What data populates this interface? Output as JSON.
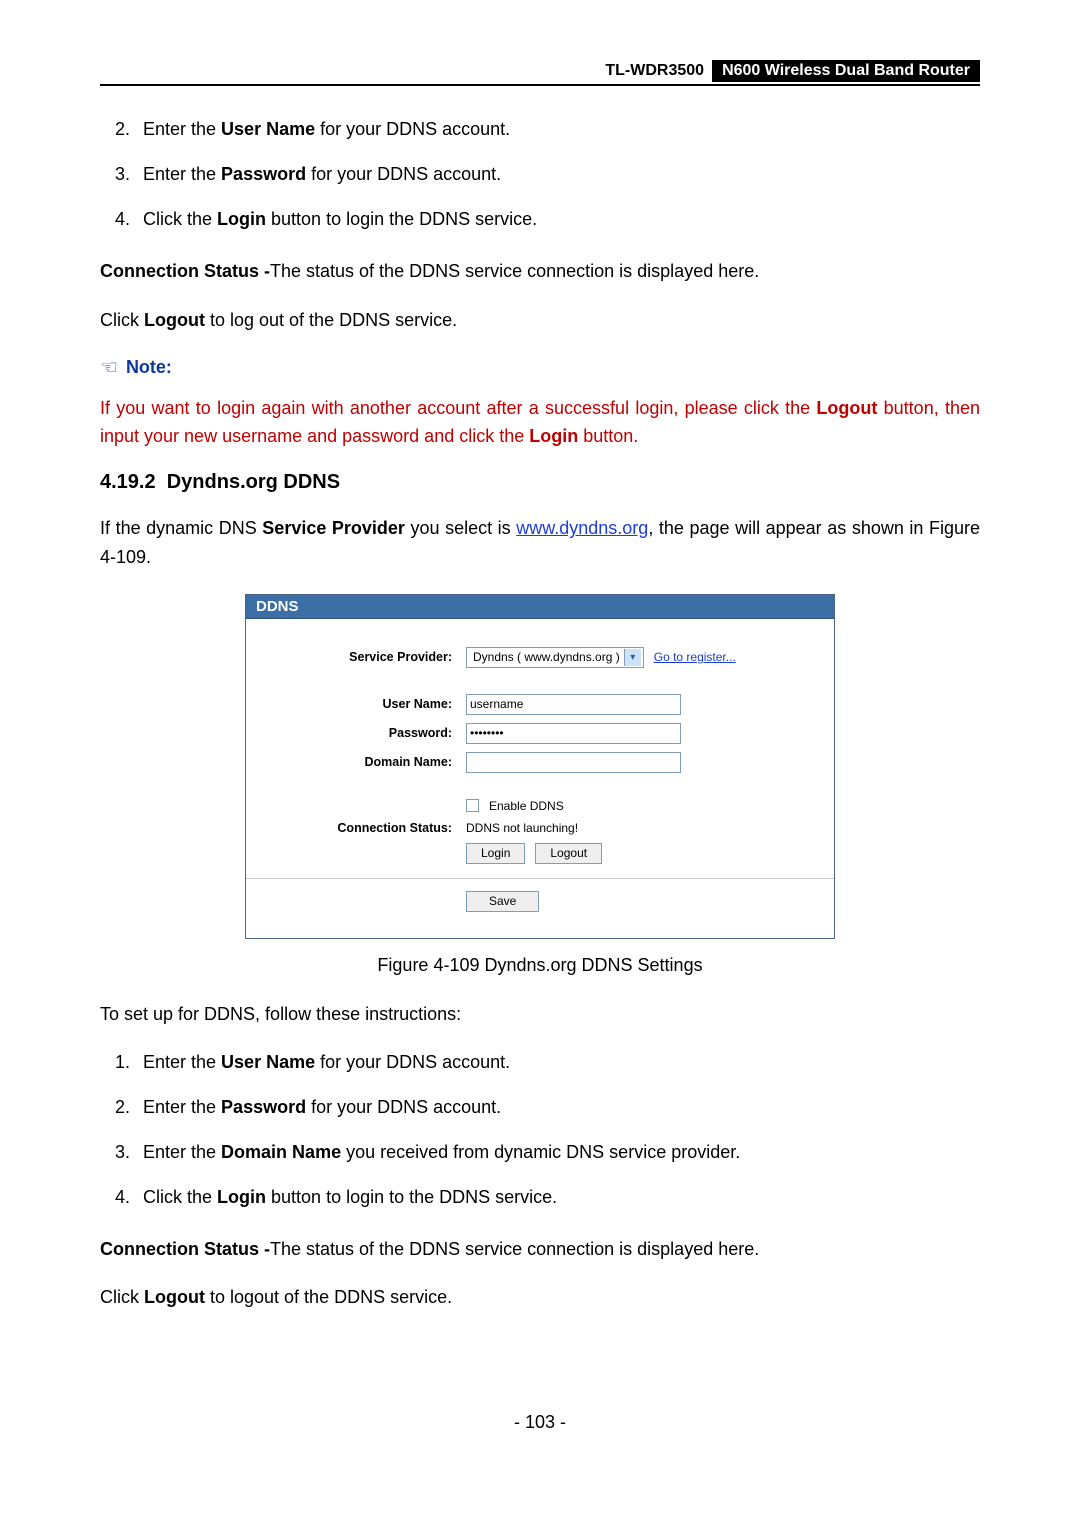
{
  "header": {
    "model": "TL-WDR3500",
    "desc": "N600 Wireless Dual Band Router"
  },
  "topSteps": [
    {
      "n": 2,
      "pre": "Enter the ",
      "b": "User Name",
      "post": " for your DDNS account."
    },
    {
      "n": 3,
      "pre": "Enter the ",
      "b": "Password",
      "post": " for your DDNS account."
    },
    {
      "n": 4,
      "pre": "Click the ",
      "b": "Login",
      "post": " button to login the DDNS service."
    }
  ],
  "connStatus1": {
    "b": "Connection Status -",
    "t": "The status of the DDNS service connection is displayed here."
  },
  "logout1": {
    "pre": "Click ",
    "b": "Logout",
    "post": " to log out of the DDNS service."
  },
  "noteLabel": "Note:",
  "noteBody": {
    "t1": " If you want to login again with another account after a successful login, please click the ",
    "b1": "Logout",
    "t2": " button, then input your new username and password and click the ",
    "b2": "Login",
    "t3": " button."
  },
  "section": {
    "num": "4.19.2",
    "title": "Dyndns.org DDNS"
  },
  "intro": {
    "t1": "If the dynamic DNS ",
    "b1": "Service Provider",
    "t2": " you select is ",
    "link": "www.dyndns.org",
    "t3": ", the page will appear as shown in Figure 4-109."
  },
  "figure": {
    "title": "DDNS",
    "labels": {
      "provider": "Service Provider:",
      "user": "User Name:",
      "pass": "Password:",
      "domain": "Domain Name:",
      "conn": "Connection Status:"
    },
    "providerValue": "Dyndns ( www.dyndns.org )",
    "registerLink": "Go to register...",
    "userValue": "username",
    "passValue": "••••••••",
    "enableDDNS": "Enable DDNS",
    "connValue": "DDNS not launching!",
    "loginBtn": "Login",
    "logoutBtn": "Logout",
    "saveBtn": "Save"
  },
  "caption": "Figure 4-109 Dyndns.org DDNS Settings",
  "setup": "To set up for DDNS, follow these instructions:",
  "bottomSteps": [
    {
      "pre": "Enter the ",
      "b": "User Name",
      "post": " for your DDNS account."
    },
    {
      "pre": "Enter the ",
      "b": "Password",
      "post": " for your DDNS account."
    },
    {
      "pre": "Enter the ",
      "b": "Domain Name",
      "post": " you received from dynamic DNS service provider."
    },
    {
      "pre": "Click the ",
      "b": "Login",
      "post": " button to login to the DDNS service."
    }
  ],
  "connStatus2": {
    "b": "Connection Status -",
    "t": "The status of the DDNS service connection is displayed here."
  },
  "logout2": {
    "pre": "Click ",
    "b": "Logout",
    "post": " to logout of the DDNS service."
  },
  "pageNo": "- 103 -"
}
